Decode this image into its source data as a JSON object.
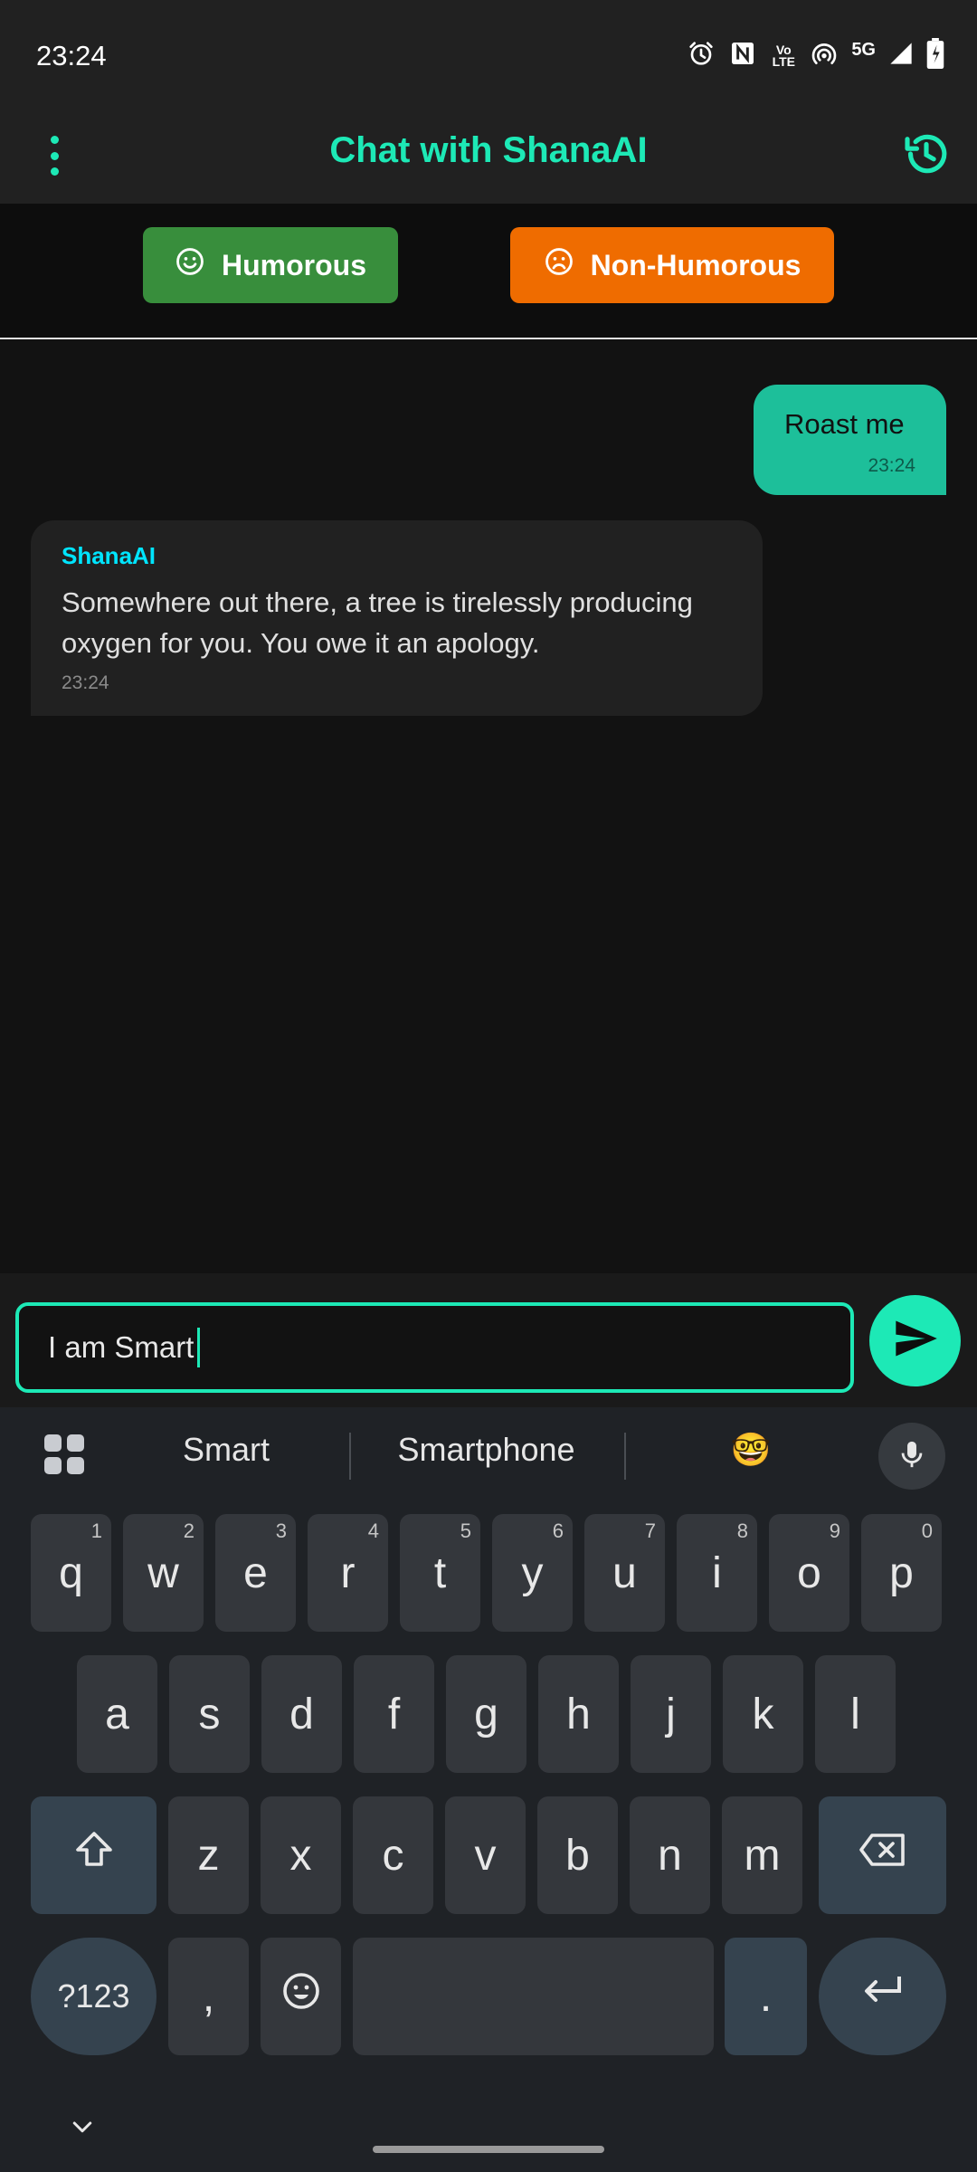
{
  "status_bar": {
    "time": "23:24",
    "icons": [
      "alarm-icon",
      "nfc-icon",
      "volte-icon",
      "hotspot-icon",
      "5g-icon",
      "signal-icon",
      "battery-icon"
    ],
    "network_label": "5G",
    "volte_label": "Vo LTE"
  },
  "app_bar": {
    "title": "Chat with ShanaAI",
    "accent_color": "#1de9b6"
  },
  "mode_buttons": {
    "humorous": {
      "label": "Humorous",
      "color": "#388e3c",
      "icon": "smile-icon"
    },
    "non_humorous": {
      "label": "Non-Humorous",
      "color": "#ef6c00",
      "icon": "sad-face-icon"
    }
  },
  "messages": [
    {
      "sender": "user",
      "text": "Roast me",
      "time": "23:24"
    },
    {
      "sender": "ShanaAI",
      "text": "Somewhere out there, a tree is tirelessly producing oxygen for you. You owe it an apology.",
      "time": "23:24"
    }
  ],
  "composer": {
    "value": "I am Smart",
    "send_icon": "send-icon"
  },
  "keyboard": {
    "suggestions": [
      "Smart",
      "Smartphone",
      "🤓"
    ],
    "rows": [
      [
        {
          "label": "q",
          "hint": "1"
        },
        {
          "label": "w",
          "hint": "2"
        },
        {
          "label": "e",
          "hint": "3"
        },
        {
          "label": "r",
          "hint": "4"
        },
        {
          "label": "t",
          "hint": "5"
        },
        {
          "label": "y",
          "hint": "6"
        },
        {
          "label": "u",
          "hint": "7"
        },
        {
          "label": "i",
          "hint": "8"
        },
        {
          "label": "o",
          "hint": "9"
        },
        {
          "label": "p",
          "hint": "0"
        }
      ],
      [
        {
          "label": "a"
        },
        {
          "label": "s"
        },
        {
          "label": "d"
        },
        {
          "label": "f"
        },
        {
          "label": "g"
        },
        {
          "label": "h"
        },
        {
          "label": "j"
        },
        {
          "label": "k"
        },
        {
          "label": "l"
        }
      ],
      [
        {
          "label": "z"
        },
        {
          "label": "x"
        },
        {
          "label": "c"
        },
        {
          "label": "v"
        },
        {
          "label": "b"
        },
        {
          "label": "n"
        },
        {
          "label": "m"
        }
      ]
    ],
    "symbols_label": "?123",
    "comma_label": ",",
    "period_label": "."
  }
}
